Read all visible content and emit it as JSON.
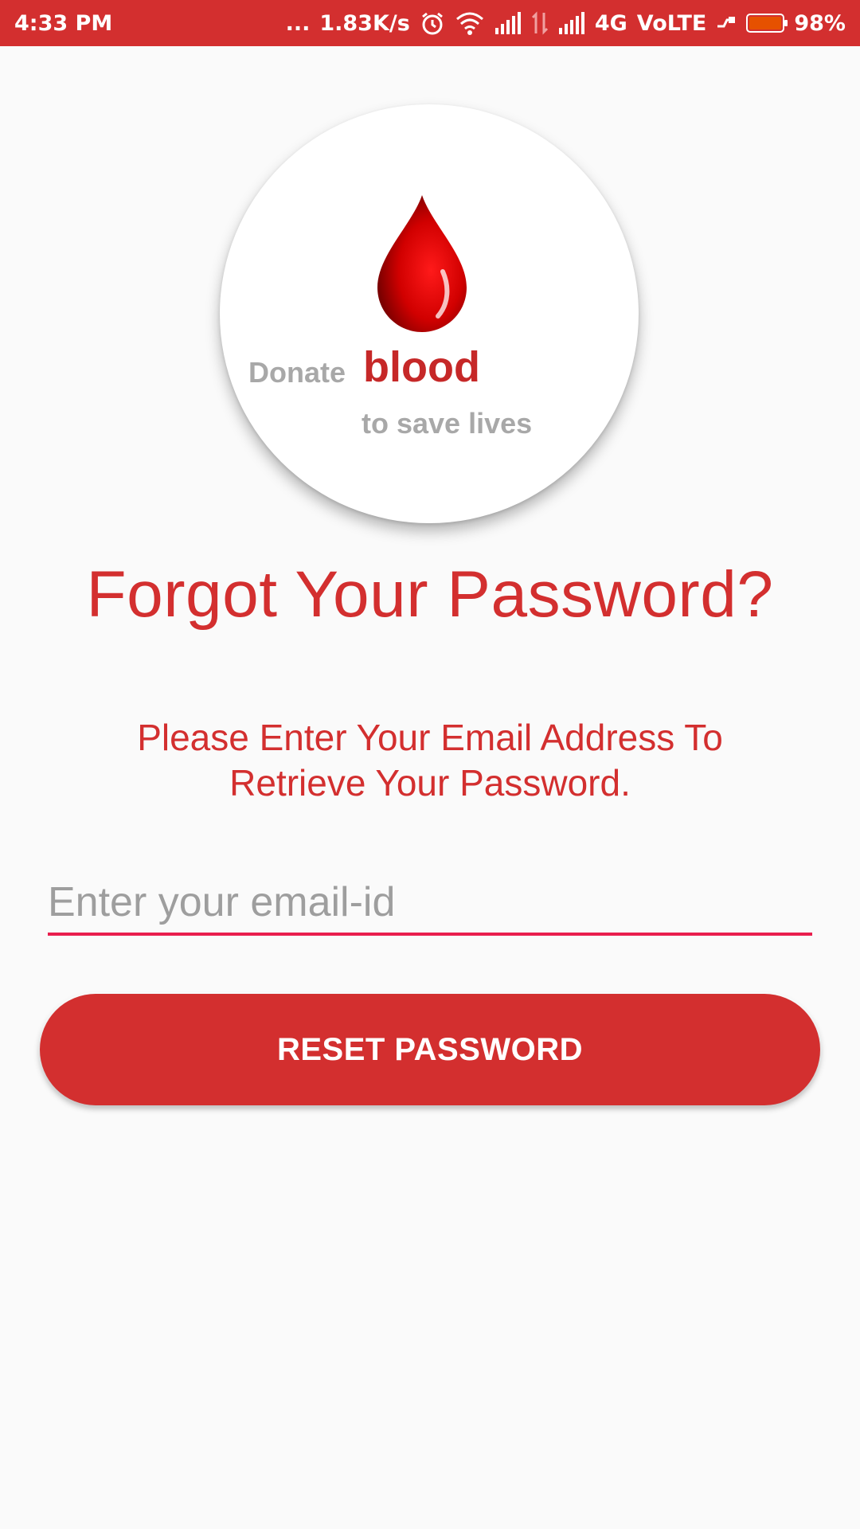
{
  "status_bar": {
    "time": "4:33 PM",
    "dots": "...",
    "network_speed": "1.83K/s",
    "network_type": "4G",
    "volte": "VoLTE",
    "battery_percent": "98%",
    "battery_level": 0.98,
    "icons": [
      "alarm-icon",
      "wifi-icon",
      "signal-icon",
      "data-arrows-icon",
      "signal-icon",
      "charging-icon",
      "battery-icon"
    ],
    "background_color": "#d32f2f"
  },
  "logo": {
    "icon": "blood-drop-icon",
    "word_donate": "Donate",
    "word_blood": "blood",
    "tagline": "to save lives"
  },
  "title": "Forgot Your Password?",
  "subtitle_line1": "Please Enter Your Email Address To",
  "subtitle_line2": "Retrieve Your Password.",
  "email": {
    "placeholder": "Enter your email-id",
    "value": ""
  },
  "reset_button": "RESET PASSWORD",
  "colors": {
    "accent": "#d32f2f",
    "input_underline": "#e91e4d",
    "background": "#fafafa"
  }
}
